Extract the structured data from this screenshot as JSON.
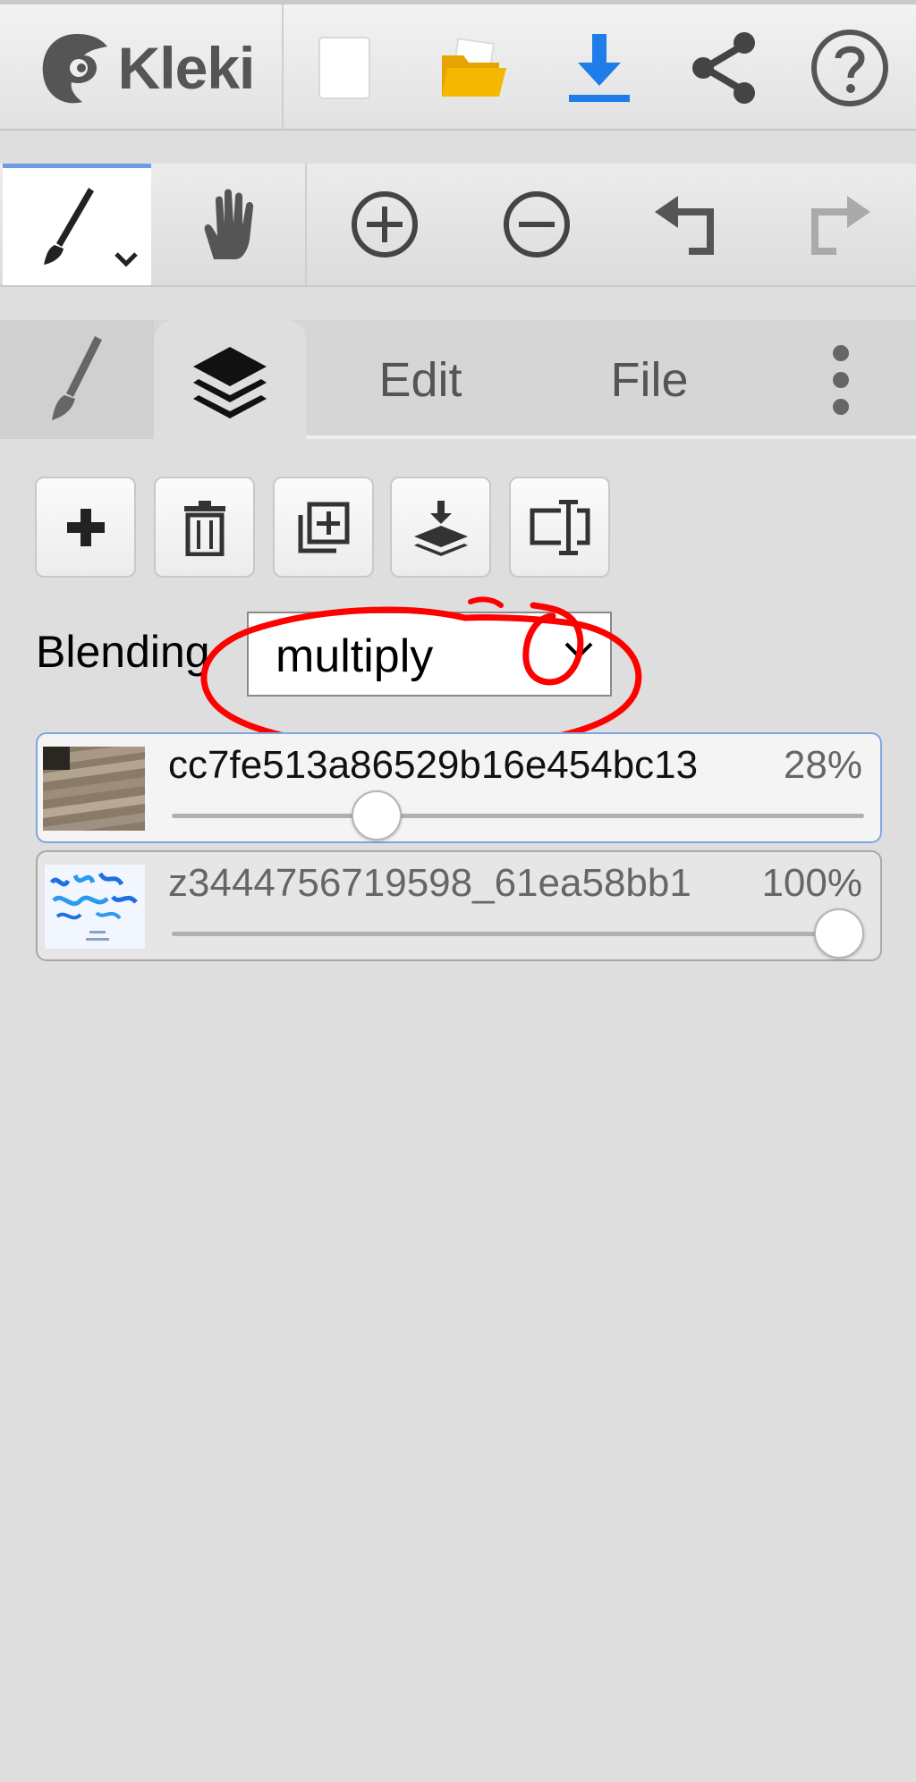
{
  "app": {
    "logo_text": "Kleki",
    "top_actions": [
      {
        "icon": "new-file-icon"
      },
      {
        "icon": "folder-open-icon"
      },
      {
        "icon": "download-icon"
      },
      {
        "icon": "share-icon"
      },
      {
        "icon": "help-icon"
      }
    ]
  },
  "toolbar": {
    "tools": [
      {
        "icon": "brush-icon",
        "active": true
      },
      {
        "icon": "hand-icon"
      },
      {
        "icon": "zoom-in-icon"
      },
      {
        "icon": "zoom-out-icon"
      },
      {
        "icon": "undo-icon"
      },
      {
        "icon": "redo-icon"
      }
    ]
  },
  "tabs": {
    "brush_icon": "brush-icon",
    "layers_icon": "layers-icon",
    "edit_label": "Edit",
    "file_label": "File",
    "more_icon": "more-vertical-icon",
    "active": "layers"
  },
  "layer_buttons": [
    {
      "icon": "plus-icon"
    },
    {
      "icon": "trash-icon"
    },
    {
      "icon": "duplicate-icon"
    },
    {
      "icon": "merge-down-icon"
    },
    {
      "icon": "rename-icon"
    }
  ],
  "blending": {
    "label": "Blending",
    "value": "multiply"
  },
  "layers": [
    {
      "name": "cc7fe513a86529b16e454bc13",
      "opacity_label": "28%",
      "opacity": 0.28,
      "selected": true
    },
    {
      "name": "z3444756719598_61ea58bb1",
      "opacity_label": "100%",
      "opacity": 1.0,
      "selected": false
    }
  ],
  "colors": {
    "accent": "#1e7de8",
    "folder": "#f5b800",
    "annotation": "#ff0000",
    "selected_border": "#7ea6e0"
  }
}
